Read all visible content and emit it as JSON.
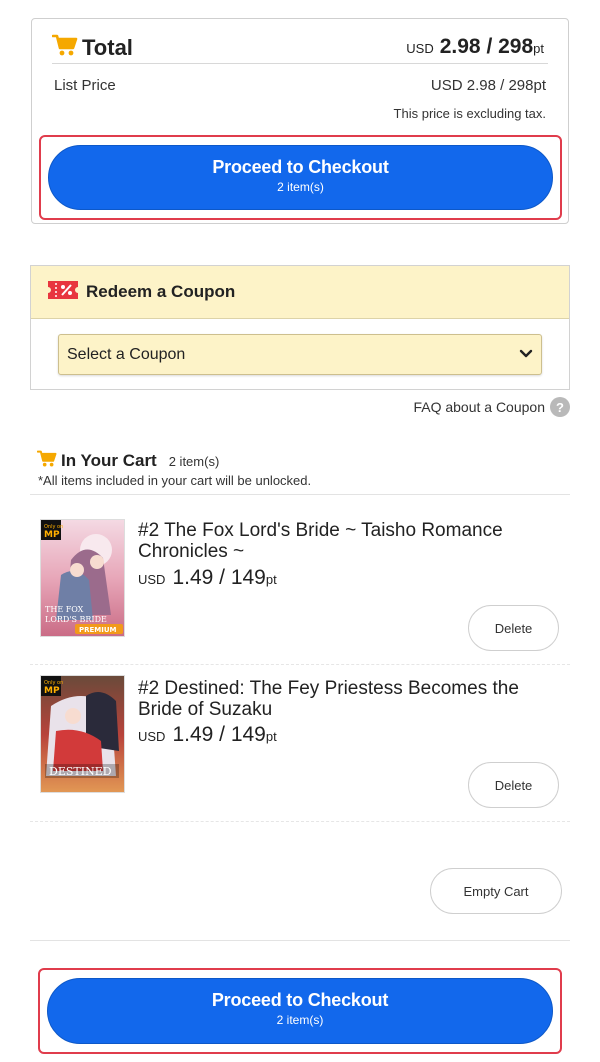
{
  "summary": {
    "title": "Total",
    "total_currency": "USD",
    "total_value": "2.98 / 298",
    "total_pt": "pt",
    "list_price_label": "List Price",
    "list_price_value": "USD 2.98 / 298pt",
    "tax_note": "This price is excluding tax."
  },
  "checkout": {
    "label": "Proceed to Checkout",
    "items": "2 item(s)"
  },
  "coupon": {
    "title": "Redeem a Coupon",
    "select_value": "Select a Coupon",
    "faq": "FAQ about a Coupon",
    "faq_icon": "?"
  },
  "cart": {
    "title": "In Your Cart",
    "count": "2 item(s)",
    "note": "*All items included in your cart will be unlocked.",
    "items": [
      {
        "title": "#2 The Fox Lord's Bride ~ Taisho Romance Chronicles ~",
        "currency": "USD",
        "price": "1.49 / 149",
        "pt": "pt",
        "delete_label": "Delete",
        "cover_badge": "MP",
        "cover_text": "THE FOX LORD'S BRIDE",
        "cover_tag": "PREMIUM"
      },
      {
        "title": "#2 Destined: The Fey Priestess Becomes the Bride of Suzaku",
        "currency": "USD",
        "price": "1.49 / 149",
        "pt": "pt",
        "delete_label": "Delete",
        "cover_badge": "MP",
        "cover_text": "DESTINED"
      }
    ],
    "empty_label": "Empty Cart"
  },
  "colors": {
    "accent_blue": "#1268ec",
    "highlight_red": "#e03c4c",
    "coupon_bg": "#fdf3c8",
    "cart_icon": "#f5a800"
  },
  "icons": {
    "cart": "shopping-cart-icon",
    "coupon": "coupon-ticket-icon",
    "chevron": "chevron-down-icon",
    "help": "help-circle-icon"
  }
}
